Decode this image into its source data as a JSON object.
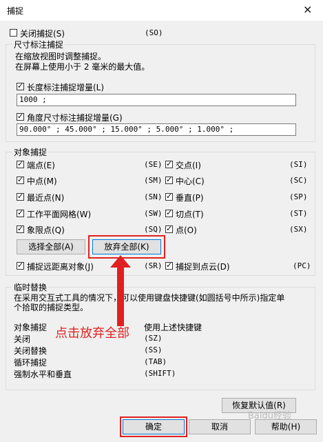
{
  "window": {
    "title": "捕捉",
    "close": "×"
  },
  "close_snap": {
    "label": "关闭捕捉(S)",
    "code": "(SO)"
  },
  "dim_snap": {
    "legend": "尺寸标注捕捉",
    "line1": "在缩放视图时调整捕捉。",
    "line2": "在屏幕上使用小于 2 毫米的最大值。",
    "linear_label": "长度标注捕捉增量(L)",
    "linear_value": "1000 ;",
    "angular_label": "角度尺寸标注捕捉增量(G)",
    "angular_value": "90.000° ; 45.000° ; 15.000° ; 5.000° ; 1.000° ;"
  },
  "object_snap": {
    "legend": "对象捕捉",
    "items": [
      {
        "label": "端点(E)",
        "code": "(SE)"
      },
      {
        "label": "交点(I)",
        "code": "(SI)"
      },
      {
        "label": "中点(M)",
        "code": "(SM)"
      },
      {
        "label": "中心(C)",
        "code": "(SC)"
      },
      {
        "label": "最近点(N)",
        "code": "(SN)"
      },
      {
        "label": "垂直(P)",
        "code": "(SP)"
      },
      {
        "label": "工作平面网格(W)",
        "code": "(SW)"
      },
      {
        "label": "切点(T)",
        "code": "(ST)"
      },
      {
        "label": "象限点(Q)",
        "code": "(SQ)"
      },
      {
        "label": "点(O)",
        "code": "(SX)"
      }
    ],
    "select_all": "选择全部(A)",
    "deselect_all": "放弃全部(K)",
    "remote": {
      "label": "捕捉远距离对象(J)",
      "code": "(SR)"
    },
    "cloud": {
      "label": "捕捉到点云(D)",
      "code": "(PC)"
    }
  },
  "temp_override": {
    "legend": "临时替换",
    "desc1": "在采用交互式工具的情况下，可以使用键盘快捷键(如圆括号中所示)指定单",
    "desc2": "个拾取的捕捉类型。",
    "rows": [
      {
        "label": "对象捕捉",
        "value": "使用上述快捷键"
      },
      {
        "label": "关闭",
        "value": "(SZ)"
      },
      {
        "label": "关闭替换",
        "value": "(SS)"
      },
      {
        "label": "循环捕捉",
        "value": "(TAB)"
      },
      {
        "label": "强制水平和垂直",
        "value": "(SHIFT)"
      }
    ]
  },
  "annotation": "点击放弃全部",
  "buttons": {
    "restore": "恢复默认值(R)",
    "ok": "确定",
    "cancel": "取消",
    "help": "帮助(H)"
  },
  "watermark": "Baidu经验"
}
